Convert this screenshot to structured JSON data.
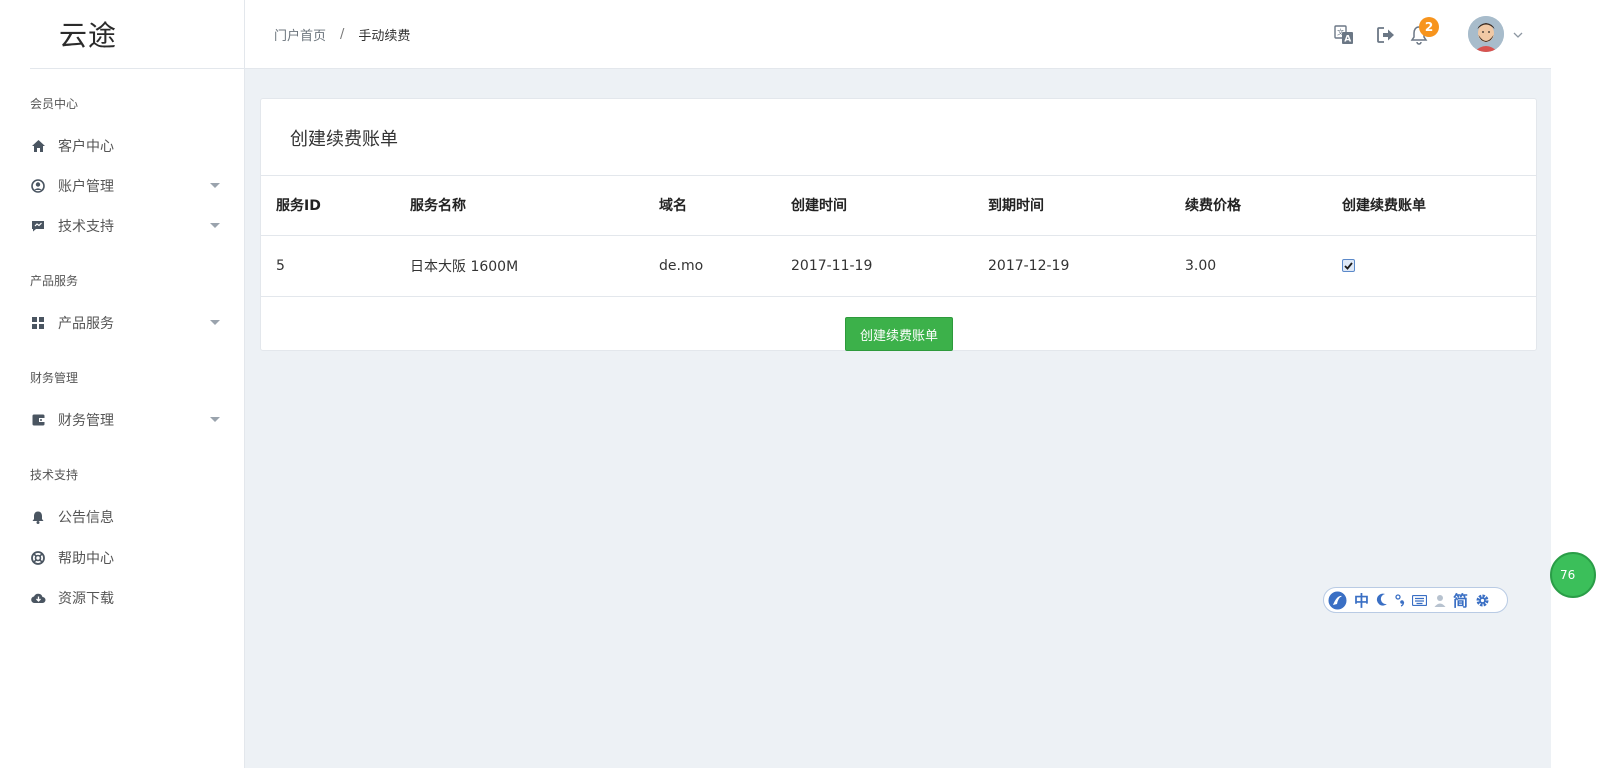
{
  "app": {
    "logo": "云途"
  },
  "sidebar": {
    "sections": [
      {
        "title": "会员中心",
        "items": [
          {
            "label": "客户中心",
            "icon": "home-icon",
            "has_caret": false
          },
          {
            "label": "账户管理",
            "icon": "user-circle-icon",
            "has_caret": true
          },
          {
            "label": "技术支持",
            "icon": "ticket-icon",
            "has_caret": true
          }
        ]
      },
      {
        "title": "产品服务",
        "items": [
          {
            "label": "产品服务",
            "icon": "grid-icon",
            "has_caret": true
          }
        ]
      },
      {
        "title": "财务管理",
        "items": [
          {
            "label": "财务管理",
            "icon": "wallet-icon",
            "has_caret": true
          }
        ]
      },
      {
        "title": "技术支持",
        "items": [
          {
            "label": "公告信息",
            "icon": "bell-icon",
            "has_caret": false
          },
          {
            "label": "帮助中心",
            "icon": "lifebuoy-icon",
            "has_caret": false
          },
          {
            "label": "资源下载",
            "icon": "cloud-download-icon",
            "has_caret": false
          }
        ]
      }
    ]
  },
  "header": {
    "breadcrumb": {
      "home": "门户首页",
      "separator": "/",
      "current": "手动续费"
    },
    "notification_count": "2"
  },
  "card": {
    "title": "创建续费账单",
    "columns": [
      "服务ID",
      "服务名称",
      "域名",
      "创建时间",
      "到期时间",
      "续费价格",
      "创建续费账单"
    ],
    "rows": [
      {
        "id": "5",
        "name": "日本大阪 1600M",
        "domain": "de.mo",
        "created": "2017-11-19",
        "expires": "2017-12-19",
        "price": "3.00",
        "checked": true
      }
    ],
    "submit_label": "创建续费账单"
  },
  "floating_widget": {
    "text": "76"
  },
  "ime_toolbar": {
    "items": [
      "中",
      "简"
    ]
  },
  "colors": {
    "accent_green": "#3cb14a",
    "badge_orange": "#f7941d",
    "ime_blue": "#3a6fc4"
  }
}
